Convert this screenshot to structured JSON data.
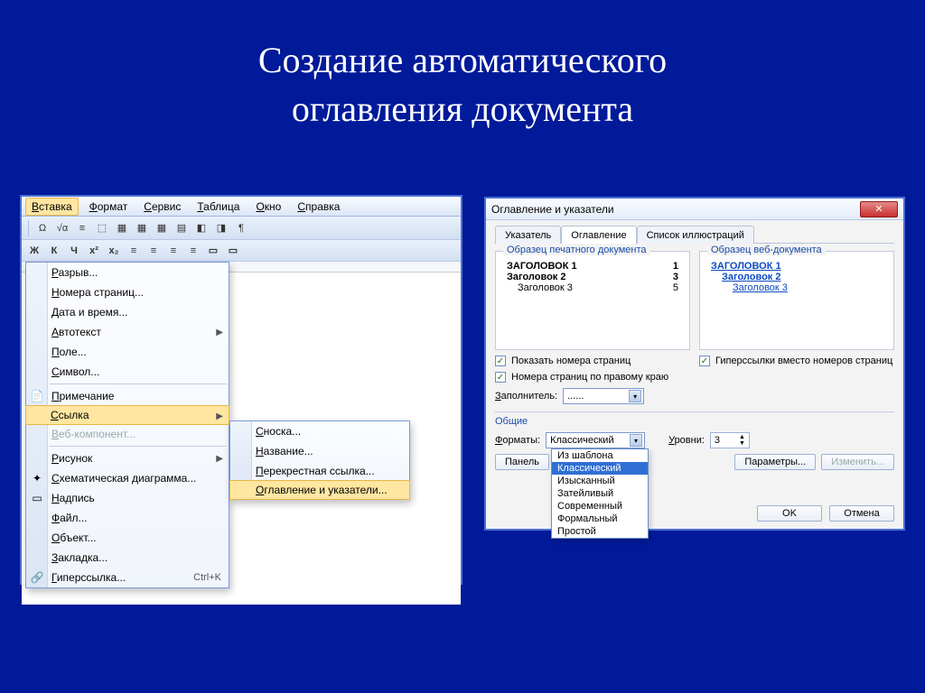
{
  "slide": {
    "title_line1": "Создание автоматического",
    "title_line2": "оглавления документа"
  },
  "menubar": [
    "Вставка",
    "Формат",
    "Сервис",
    "Таблица",
    "Окно",
    "Справка"
  ],
  "toolbar_icons": [
    "Ω",
    "√α",
    "≡",
    "⬚",
    "▦",
    "▦",
    "▦",
    "▤",
    "◧",
    "◨",
    "¶"
  ],
  "format_icons": [
    "Ж",
    "К",
    "Ч",
    "x²",
    "x₂",
    "≡",
    "≡",
    "≡",
    "≡",
    "▭",
    "▭"
  ],
  "insert_menu": [
    {
      "label": "Разрыв...",
      "icon": ""
    },
    {
      "label": "Номера страниц...",
      "icon": ""
    },
    {
      "label": "Дата и время...",
      "icon": ""
    },
    {
      "label": "Автотекст",
      "icon": "",
      "submenu": true
    },
    {
      "label": "Поле...",
      "icon": ""
    },
    {
      "label": "Символ...",
      "icon": ""
    },
    {
      "label": "Примечание",
      "icon": "📄"
    },
    {
      "label": "Ссылка",
      "icon": "",
      "submenu": true,
      "highlight": true
    },
    {
      "label": "Веб-компонент...",
      "icon": "",
      "disabled": true
    },
    {
      "label": "Рисунок",
      "icon": "",
      "submenu": true
    },
    {
      "label": "Схематическая диаграмма...",
      "icon": "✦"
    },
    {
      "label": "Надпись",
      "icon": "▭"
    },
    {
      "label": "Файл...",
      "icon": ""
    },
    {
      "label": "Объект...",
      "icon": ""
    },
    {
      "label": "Закладка...",
      "icon": ""
    },
    {
      "label": "Гиперссылка...",
      "icon": "🔗",
      "hotkey": "Ctrl+K"
    }
  ],
  "reference_submenu": [
    {
      "label": "Сноска..."
    },
    {
      "label": "Название..."
    },
    {
      "label": "Перекрестная ссылка..."
    },
    {
      "label": "Оглавление и указатели...",
      "highlight": true
    }
  ],
  "dialog": {
    "title": "Оглавление и указатели",
    "tabs": [
      "Указатель",
      "Оглавление",
      "Список иллюстраций"
    ],
    "active_tab": "Оглавление",
    "print_preview_label": "Образец печатного документа",
    "web_preview_label": "Образец веб-документа",
    "print_preview": [
      {
        "text": "ЗАГОЛОВОК 1",
        "page": "1",
        "level": 0,
        "bold": true
      },
      {
        "text": "Заголовок 2",
        "page": "3",
        "level": 0,
        "bold": true
      },
      {
        "text": "Заголовок 3",
        "page": "5",
        "level": 1,
        "bold": false
      }
    ],
    "web_preview": [
      {
        "text": "ЗАГОЛОВОК 1",
        "level": 0
      },
      {
        "text": "Заголовок 2",
        "level": 1
      },
      {
        "text": "Заголовок 3",
        "level": 2
      }
    ],
    "chk_show_pages": "Показать номера страниц",
    "chk_right_align": "Номера страниц по правому краю",
    "chk_hyperlinks": "Гиперссылки вместо номеров страниц",
    "filler_label": "Заполнитель:",
    "filler_value": "......",
    "common_label": "Общие",
    "formats_label": "Форматы:",
    "formats_value": "Классический",
    "formats_options": [
      "Из шаблона",
      "Классический",
      "Изысканный",
      "Затейливый",
      "Современный",
      "Формальный",
      "Простой"
    ],
    "levels_label": "Уровни:",
    "levels_value": "3",
    "panel_button": "Панель",
    "params_button": "Параметры...",
    "modify_button": "Изменить...",
    "ok": "OK",
    "cancel": "Отмена"
  }
}
